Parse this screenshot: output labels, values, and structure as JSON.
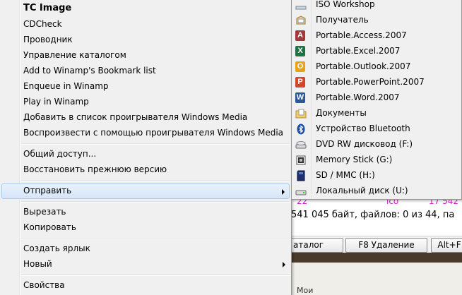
{
  "background": {
    "info_text": "541 045 байт, файлов: 0 из 44, па",
    "colored_row": [
      {
        "text": "22",
        "color": "#d020d0"
      },
      {
        "text": "ico",
        "color": "#d020d0"
      },
      {
        "text": "17 542",
        "color": "#d020d0"
      }
    ],
    "function_keys": [
      "аталог",
      "F8 Удаление",
      "Alt+F"
    ],
    "bottom_text": "Мои"
  },
  "context_menu": {
    "items": [
      {
        "label": "TC Image",
        "bold": true
      },
      {
        "label": "CDCheck"
      },
      {
        "label": "Проводник"
      },
      {
        "label": "Управление каталогом"
      },
      {
        "label": "Add to Winamp's Bookmark list"
      },
      {
        "label": "Enqueue in Winamp"
      },
      {
        "label": "Play in Winamp"
      },
      {
        "label": "Добавить в список проигрывателя Windows Media"
      },
      {
        "label": "Воспроизвести с помощью проигрывателя Windows Media"
      },
      {
        "label": "Общий доступ..."
      },
      {
        "label": "Восстановить прежнюю версию"
      },
      {
        "label": "Отправить",
        "submenu": true,
        "highlighted": true
      },
      {
        "label": "Вырезать"
      },
      {
        "label": "Копировать"
      },
      {
        "label": "Создать ярлык"
      },
      {
        "label": "Новый",
        "submenu": true
      },
      {
        "label": "Свойства"
      }
    ]
  },
  "send_to_submenu": {
    "items": [
      {
        "label": "ISO Workshop",
        "icon": "iso-workshop-icon"
      },
      {
        "label": "Получатель",
        "icon": "mail-recipient-icon"
      },
      {
        "label": "Portable.Access.2007",
        "icon": "access-icon",
        "letter": "A",
        "color": "#a4373a"
      },
      {
        "label": "Portable.Excel.2007",
        "icon": "excel-icon",
        "letter": "X",
        "color": "#1f7244"
      },
      {
        "label": "Portable.Outlook.2007",
        "icon": "outlook-icon",
        "letter": "O",
        "color": "#e8a317"
      },
      {
        "label": "Portable.PowerPoint.2007",
        "icon": "powerpoint-icon",
        "letter": "P",
        "color": "#d24726"
      },
      {
        "label": "Portable.Word.2007",
        "icon": "word-icon",
        "letter": "W",
        "color": "#2b579a"
      },
      {
        "label": "Документы",
        "icon": "documents-folder-icon"
      },
      {
        "label": "Устройство Bluetooth",
        "icon": "bluetooth-icon"
      },
      {
        "label": "DVD RW дисковод (F:)",
        "icon": "dvd-drive-icon"
      },
      {
        "label": "Memory Stick (G:)",
        "icon": "memory-stick-icon"
      },
      {
        "label": "SD / MMC (H:)",
        "icon": "sd-card-icon"
      },
      {
        "label": "Локальный диск (U:)",
        "icon": "local-disk-icon"
      }
    ]
  }
}
